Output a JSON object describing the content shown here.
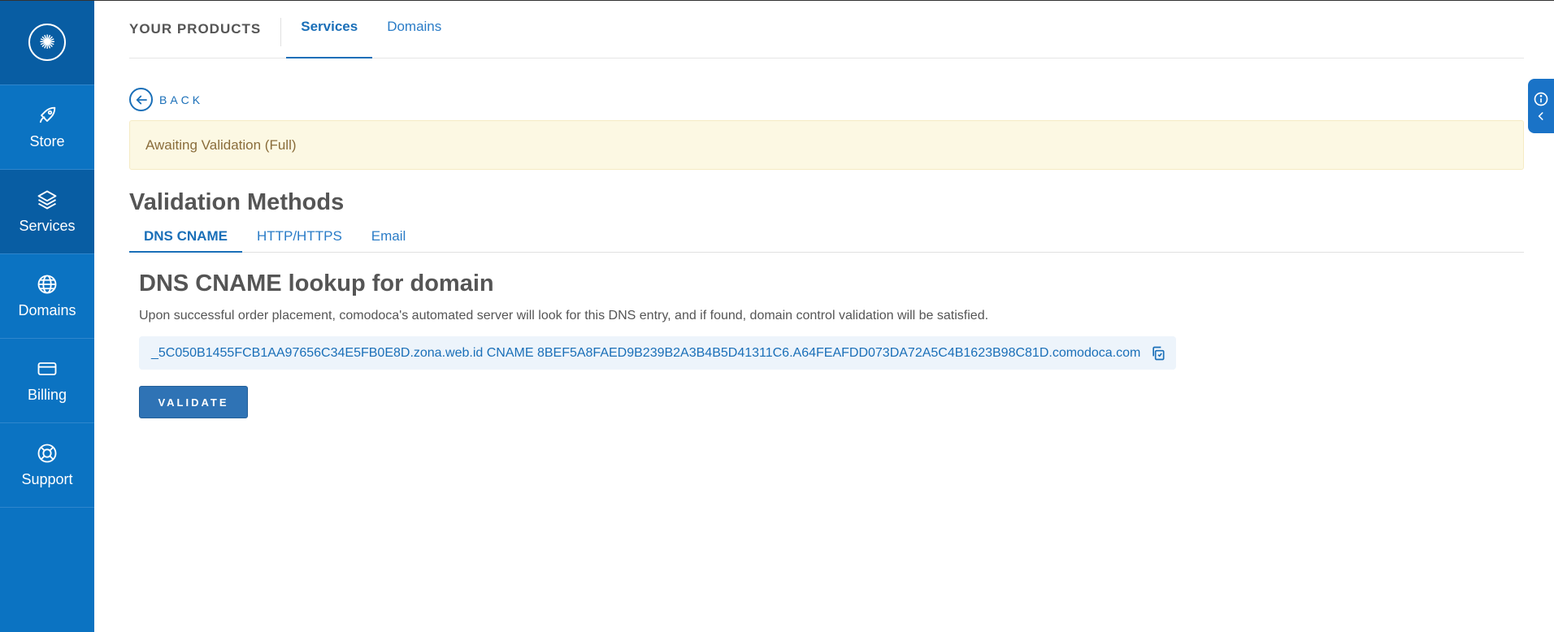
{
  "sidebar": {
    "items": [
      {
        "label": "Store",
        "icon": "rocket-icon"
      },
      {
        "label": "Services",
        "icon": "layers-icon"
      },
      {
        "label": "Domains",
        "icon": "globe-icon"
      },
      {
        "label": "Billing",
        "icon": "credit-card-icon"
      },
      {
        "label": "Support",
        "icon": "lifebuoy-icon"
      }
    ],
    "active": "Services"
  },
  "header": {
    "title": "YOUR PRODUCTS",
    "tabs": [
      {
        "label": "Services",
        "active": true
      },
      {
        "label": "Domains",
        "active": false
      }
    ]
  },
  "back_label": "BACK",
  "alert_text": "Awaiting Validation (Full)",
  "section_title": "Validation Methods",
  "method_tabs": [
    {
      "label": "DNS CNAME",
      "active": true
    },
    {
      "label": "HTTP/HTTPS",
      "active": false
    },
    {
      "label": "Email",
      "active": false
    }
  ],
  "panel": {
    "title": "DNS CNAME lookup for domain",
    "description": "Upon successful order placement, comodoca's automated server will look for this DNS entry, and if found, domain control validation will be satisfied.",
    "record": "_5C050B1455FCB1AA97656C34E5FB0E8D.zona.web.id CNAME 8BEF5A8FAED9B239B2A3B4B5D41311C6.A64FEAFDD073DA72A5C4B1623B98C81D.comodoca.com",
    "validate_label": "VALIDATE"
  },
  "colors": {
    "sidebar": "#0b73c2",
    "sidebar_dark": "#085da3",
    "accent": "#1a6fb8",
    "alert_bg": "#fcf8e3",
    "alert_text": "#8a6d3b"
  }
}
